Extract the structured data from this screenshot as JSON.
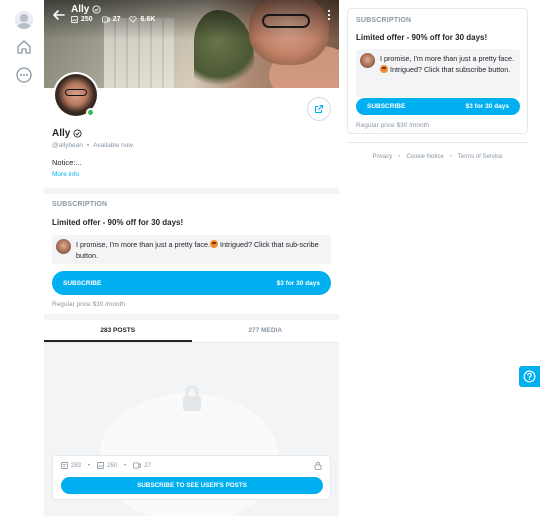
{
  "profile": {
    "name": "Ally",
    "handle": "@allybean",
    "status": "Available now",
    "bio": "Notice:...",
    "more_info": "More info",
    "stats": {
      "photos": "250",
      "videos": "27",
      "likes": "6.6K"
    }
  },
  "subscription": {
    "label": "SUBSCRIPTION",
    "offer_title": "Limited offer - 90% off for 30 days!",
    "promo_text_a": "I promise, I'm more than just a pretty face.",
    "promo_text_b": " Intrigued? Click that sub-scribe button.",
    "promo_text_b_side": " Intrigued? Click that subscribe button.",
    "button_label": "SUBSCRIBE",
    "button_price": "$3 for 30 days",
    "regular_price_main": "Regular price $30 /month",
    "regular_price_side": "Regular price $30 /month"
  },
  "tabs": [
    {
      "label": "283 POSTS",
      "active": true
    },
    {
      "label": "277 MEDIA",
      "active": false
    }
  ],
  "locked": {
    "posts": "283",
    "photos": "250",
    "videos": "27",
    "button": "SUBSCRIBE TO SEE USER'S POSTS"
  },
  "footer": {
    "privacy": "Privacy",
    "cookie": "Cookie Notice",
    "terms": "Terms of Service"
  },
  "colors": {
    "accent": "#00aff0",
    "online": "#2fbf4f",
    "muted": "#8a96a3"
  }
}
